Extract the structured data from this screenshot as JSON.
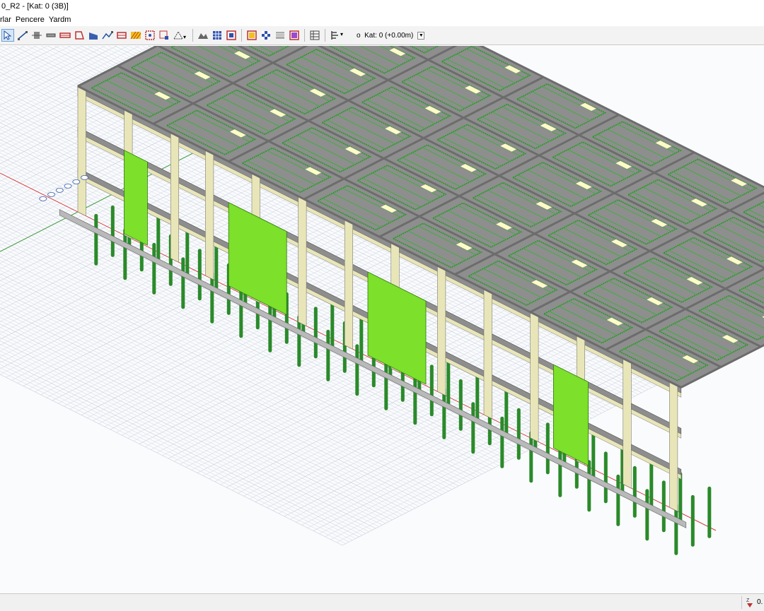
{
  "window": {
    "title": "0_R2 - [Kat: 0 (3B)]"
  },
  "menu": {
    "items": [
      "rlar",
      "Pencere",
      "Yardm"
    ]
  },
  "toolbar": {
    "floor_label": "Kat: 0 (+0.00m)",
    "floor_radio_glyph": "o",
    "dropdown_glyph": "▼",
    "more_glyph": "▾",
    "icons": [
      "pointer-icon",
      "line-icon",
      "column-icon",
      "beam-icon",
      "wall-icon",
      "slab-icon",
      "stair-icon",
      "polyline-icon",
      "truss-icon",
      "hatch-icon",
      "region-icon",
      "node-icon",
      "axis-icon",
      "gallery-icon",
      "grid-icon",
      "frame-icon",
      "window-icon",
      "checker-icon",
      "list-icon",
      "table-icon",
      "column-list-icon"
    ]
  },
  "colors": {
    "wall_green": "#7de02a",
    "slab_grey": "#8e8e8e",
    "column_cream": "#e8e6b8",
    "pile_green": "#2a8a2a",
    "grid_line": "#d8dde6",
    "axis_red": "#d83a3a",
    "axis_green": "#3a9a3a"
  },
  "status": {
    "value": "0.",
    "icon": "z-axis-icon"
  }
}
